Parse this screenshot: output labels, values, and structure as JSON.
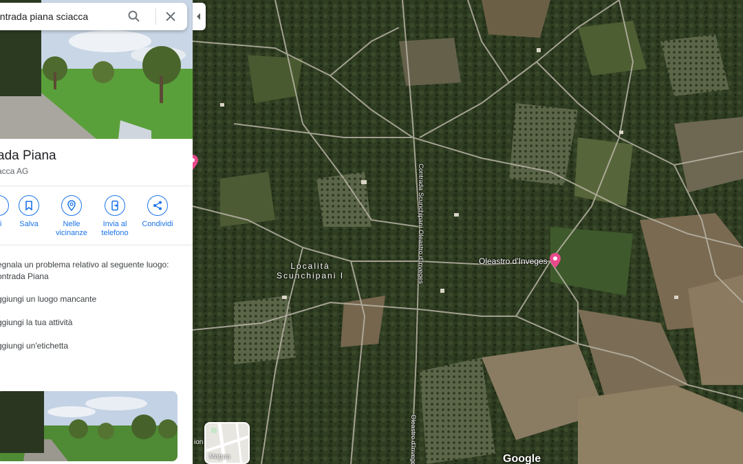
{
  "search": {
    "query": "ontrada piana sciacca"
  },
  "place": {
    "title": "ada Piana",
    "subtitle": "acca AG"
  },
  "actions": [
    {
      "label": "ni",
      "icon": "directions-icon"
    },
    {
      "label": "Salva",
      "icon": "bookmark-icon"
    },
    {
      "label": "Nelle vicinanze",
      "icon": "nearby-icon"
    },
    {
      "label": "Invia al telefono",
      "icon": "send-to-phone-icon"
    },
    {
      "label": "Condividi",
      "icon": "share-icon"
    }
  ],
  "report": {
    "line1": "egnala un problema relativo al seguente luogo:",
    "line2": "ontrada Piana"
  },
  "links": {
    "add_place": "ggiungi un luogo mancante",
    "add_business": "ggiungi la tua attività",
    "add_label": "ggiungi un'etichetta"
  },
  "map": {
    "locality_line1": "Località",
    "locality_line2": "Scunchipani I",
    "road_label_1": "Contrada Scunchipani Oleastro d'Inveges",
    "road_label_2": "Oleastro d'Inveges",
    "poi_label": "Oleastro d'Inveges",
    "toggle_label": "Mappa",
    "partial_label": "ion",
    "attribution": "Google"
  },
  "colors": {
    "accent": "#1a73e8",
    "pin": "#e84a8b"
  }
}
